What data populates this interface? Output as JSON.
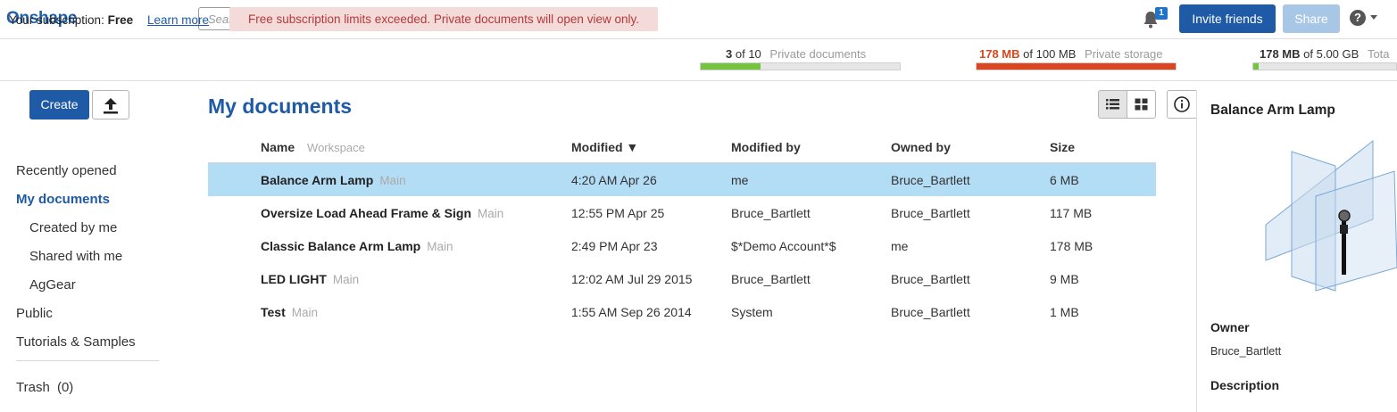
{
  "header": {
    "logo": "Onshape",
    "search_placeholder": "Search documents",
    "notification_count": "1",
    "invite_label": "Invite friends",
    "share_label": "Share",
    "help_label": "?"
  },
  "subscription": {
    "label": "Your subscription:",
    "plan": "Free",
    "learn_more": "Learn more",
    "warning": "Free subscription limits exceeded. Private documents will open view only.",
    "usage": [
      {
        "value": "3",
        "of": "of 10",
        "label": "Private documents",
        "fill_fraction": 0.3,
        "color": "#74c43d"
      },
      {
        "value": "178 MB",
        "of": "of 100 MB",
        "label": "Private storage",
        "fill_fraction": 1.0,
        "color": "#d9461f"
      },
      {
        "value": "178 MB",
        "of": "of 5.00 GB",
        "label": "Tota",
        "fill_fraction": 0.035,
        "color": "#74c43d"
      }
    ]
  },
  "sidebar": {
    "create_label": "Create",
    "items": [
      {
        "label": "Recently opened",
        "active": false
      },
      {
        "label": "My documents",
        "active": true
      },
      {
        "label": "Created by me",
        "active": false
      },
      {
        "label": "Shared with me",
        "active": false
      },
      {
        "label": "AgGear",
        "active": false
      },
      {
        "label": "Public",
        "active": false
      },
      {
        "label": "Tutorials & Samples",
        "active": false
      }
    ],
    "trash_label": "Trash",
    "trash_count": "(0)"
  },
  "main": {
    "title": "My documents",
    "columns": {
      "name": "Name",
      "workspace": "Workspace",
      "modified": "Modified ▼",
      "modified_by": "Modified by",
      "owned_by": "Owned by",
      "size": "Size"
    },
    "rows": [
      {
        "name": "Balance Arm Lamp",
        "workspace": "Main",
        "modified": "4:20 AM Apr 26",
        "modified_by": "me",
        "owner": "Bruce_Bartlett",
        "size": "6 MB",
        "selected": true
      },
      {
        "name": "Oversize Load Ahead Frame & Sign",
        "workspace": "Main",
        "modified": "12:55 PM Apr 25",
        "modified_by": "Bruce_Bartlett",
        "owner": "Bruce_Bartlett",
        "size": "117 MB",
        "selected": false
      },
      {
        "name": "Classic Balance Arm Lamp",
        "workspace": "Main",
        "modified": "2:49 PM Apr 23",
        "modified_by": "$*Demo Account*$",
        "owner": "me",
        "size": "178 MB",
        "selected": false
      },
      {
        "name": "LED LIGHT",
        "workspace": "Main",
        "modified": "12:02 AM Jul 29 2015",
        "modified_by": "Bruce_Bartlett",
        "owner": "Bruce_Bartlett",
        "size": "9 MB",
        "selected": false
      },
      {
        "name": "Test",
        "workspace": "Main",
        "modified": "1:55 AM Sep 26 2014",
        "modified_by": "System",
        "owner": "Bruce_Bartlett",
        "size": "1 MB",
        "selected": false
      }
    ]
  },
  "details": {
    "title": "Balance Arm Lamp",
    "owner_label": "Owner",
    "owner_value": "Bruce_Bartlett",
    "description_label": "Description"
  },
  "colors": {
    "brand": "#1e5aa5",
    "selected_row": "#b3dcf5",
    "warning_bg": "#f5dada",
    "warning_text": "#b23a3a"
  }
}
